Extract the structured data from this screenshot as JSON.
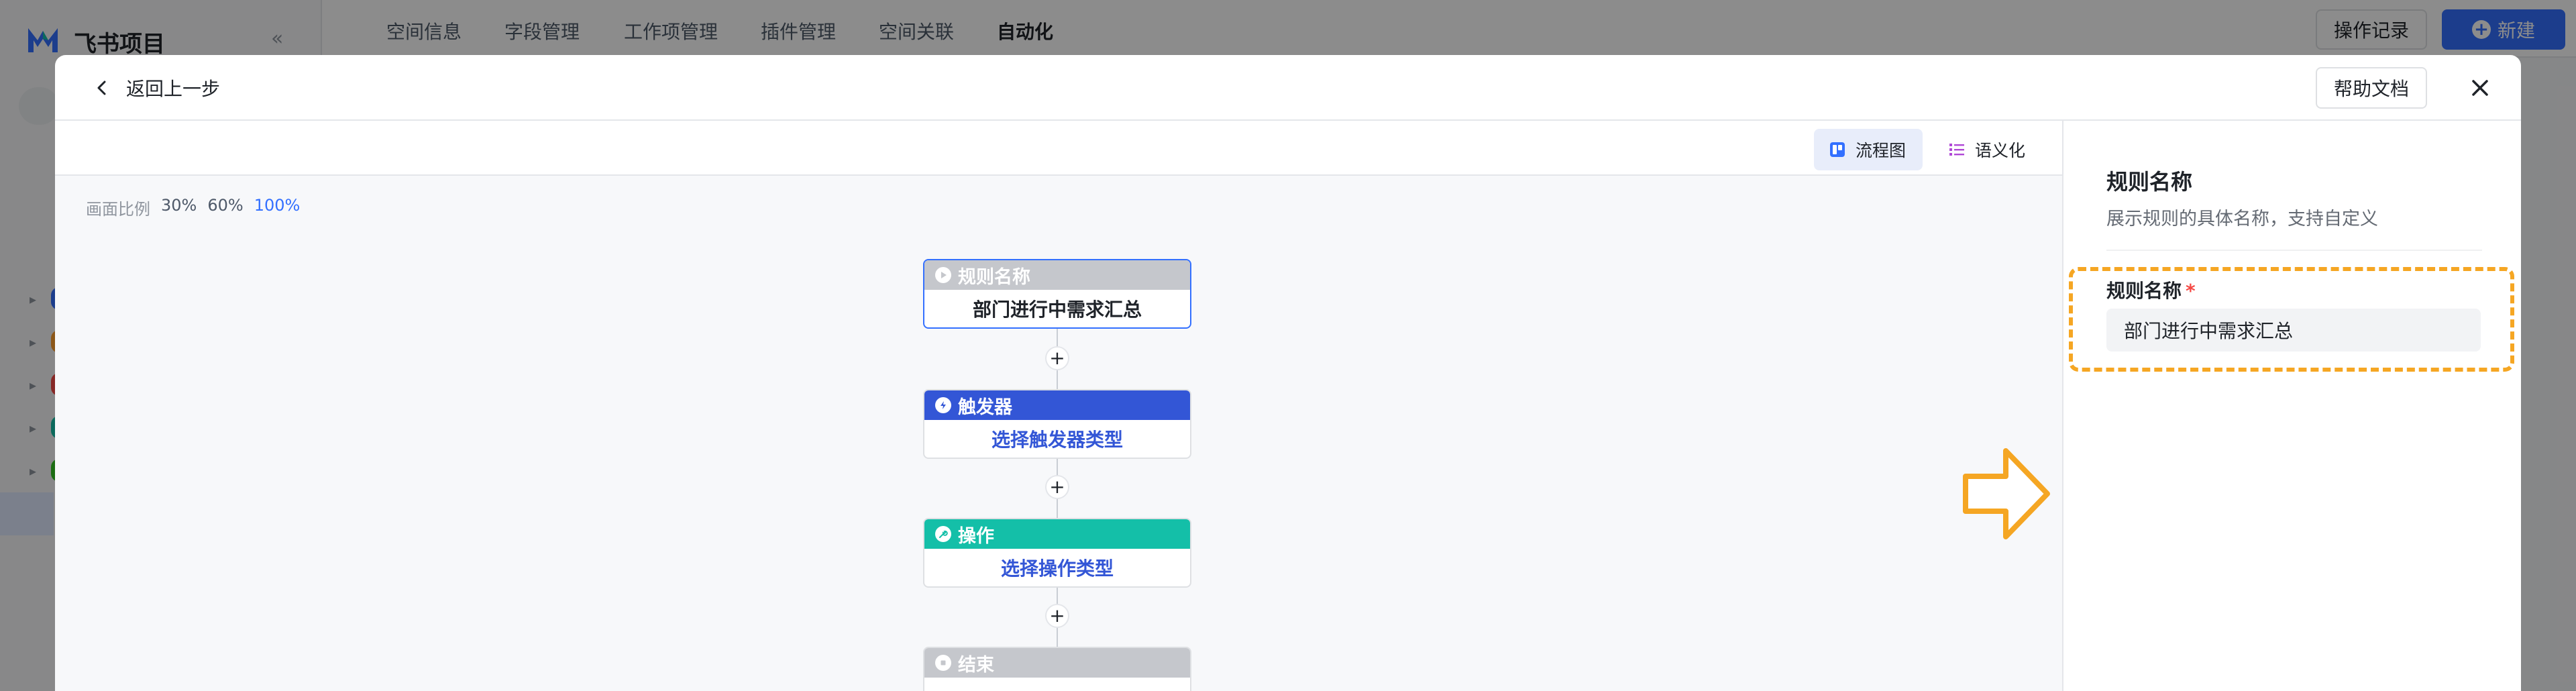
{
  "background_app": {
    "app_name": "飞书项目",
    "tabs": [
      "空间信息",
      "字段管理",
      "工作项管理",
      "插件管理",
      "空间关联",
      "自动化"
    ],
    "active_tab": "自动化",
    "operation_log_label": "操作记录",
    "new_button_label": "新建"
  },
  "modal": {
    "back_label": "返回上一步",
    "help_label": "帮助文档"
  },
  "toolbar": {
    "flow_label": "流程图",
    "semantic_label": "语义化",
    "active_view": "流程图"
  },
  "canvas": {
    "scale_label": "画面比例",
    "scale_options": [
      "30%",
      "60%",
      "100%"
    ],
    "active_scale": "100%",
    "nodes": [
      {
        "title": "规则名称",
        "body": "部门进行中需求汇总"
      },
      {
        "title": "触发器",
        "body": "选择触发器类型"
      },
      {
        "title": "操作",
        "body": "选择操作类型"
      },
      {
        "title": "结束",
        "body": ""
      }
    ],
    "add_symbol": "+"
  },
  "panel": {
    "title": "规则名称",
    "description": "展示规则的具体名称，支持自定义",
    "field_label": "规则名称",
    "required_mark": "*",
    "field_value": "部门进行中需求汇总"
  },
  "colors": {
    "brand_blue": "#3370ff",
    "trigger_header": "#3356d6",
    "action_header": "#14bfa8",
    "neutral_header": "#c5c7cc",
    "highlight_orange": "#f5a623"
  }
}
